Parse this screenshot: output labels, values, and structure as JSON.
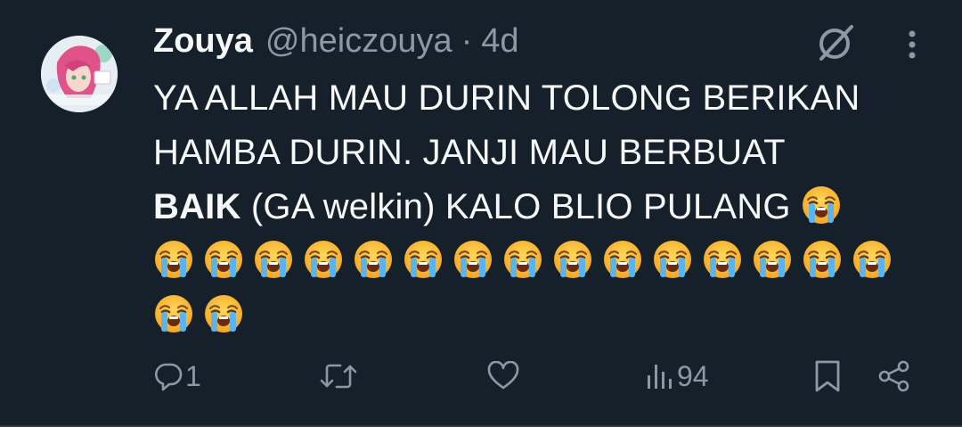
{
  "tweet": {
    "display_name": "Zouya",
    "handle": "@heiczouya",
    "separator": "·",
    "time": "4d",
    "line1": "YA ALLAH MAU DURIN TOLONG BERIKAN",
    "line2": "HAMBA DURIN. JANJI MAU BERBUAT",
    "line3_bold": "BAIK",
    "line3_rest": " (GA welkin) KALO BLIO PULANG ",
    "emoji": "loudly-crying-face",
    "emoji_count_line3": 1,
    "emoji_count_line4": 15,
    "emoji_count_line5": 2
  },
  "actions": {
    "reply_count": "1",
    "retweet_count": "",
    "like_count": "",
    "view_count": "94"
  },
  "icons": {
    "grok": "grok-icon",
    "more": "more-vertical-icon",
    "reply": "reply-icon",
    "retweet": "retweet-icon",
    "like": "heart-icon",
    "views": "views-icon",
    "bookmark": "bookmark-icon",
    "share": "share-icon"
  },
  "colors": {
    "background": "#15202b",
    "text": "#f7f9f9",
    "secondary": "#8b98a5"
  }
}
